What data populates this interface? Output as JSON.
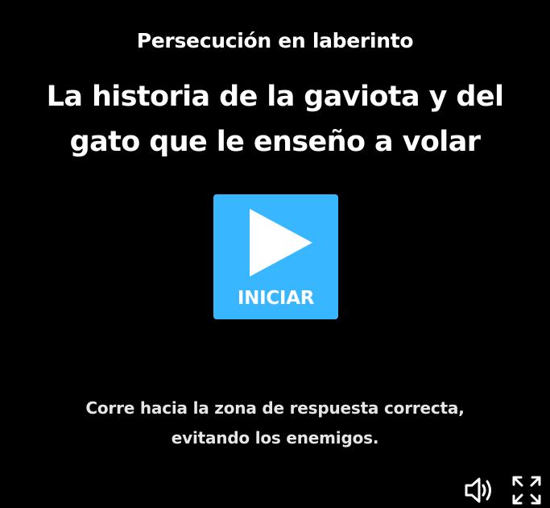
{
  "header": {
    "subtitle": "Persecución en laberinto",
    "title": "La historia de la gaviota y del gato que le enseño a volar"
  },
  "start_button": {
    "label": "INICIAR",
    "icon": "play-icon",
    "color": "#38b6ff"
  },
  "instructions": {
    "text": "Corre hacia la zona de respuesta correcta, evitando los enemigos."
  },
  "controls": {
    "volume_icon": "speaker-icon",
    "fullscreen_icon": "fullscreen-expand-icon"
  },
  "colors": {
    "background": "#000000",
    "text": "#ffffff",
    "accent": "#38b6ff"
  }
}
